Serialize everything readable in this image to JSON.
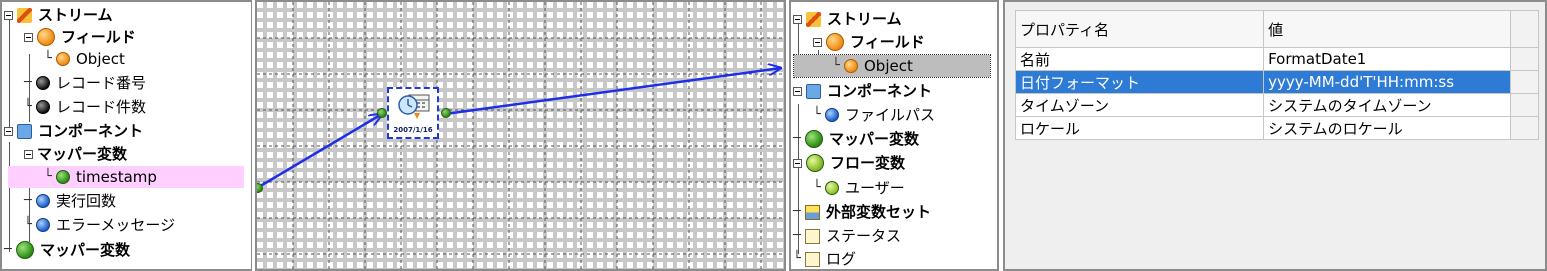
{
  "left_tree": {
    "items": [
      {
        "label": "ストリーム",
        "bold": true
      },
      {
        "label": "フィールド",
        "bold": true
      },
      {
        "label": "Object",
        "bold": false
      },
      {
        "label": "レコード番号",
        "bold": false
      },
      {
        "label": "レコード件数",
        "bold": false
      },
      {
        "label": "コンポーネント",
        "bold": true
      },
      {
        "label": "マッパー変数",
        "bold": true
      },
      {
        "label": "timestamp",
        "bold": false
      },
      {
        "label": "実行回数",
        "bold": false
      },
      {
        "label": "エラーメッセージ",
        "bold": false
      },
      {
        "label": "マッパー変数",
        "bold": true
      }
    ]
  },
  "canvas": {
    "component_label": "2007/1/16"
  },
  "right_tree": {
    "items": [
      {
        "label": "ストリーム",
        "bold": true
      },
      {
        "label": "フィールド",
        "bold": true
      },
      {
        "label": "Object",
        "bold": false
      },
      {
        "label": "コンポーネント",
        "bold": true
      },
      {
        "label": "ファイルパス",
        "bold": false
      },
      {
        "label": "マッパー変数",
        "bold": true
      },
      {
        "label": "フロー変数",
        "bold": true
      },
      {
        "label": "ユーザー",
        "bold": false
      },
      {
        "label": "外部変数セット",
        "bold": true
      },
      {
        "label": "ステータス",
        "bold": false
      },
      {
        "label": "ログ",
        "bold": false
      }
    ]
  },
  "properties": {
    "headers": {
      "name": "プロパティ名",
      "value": "値"
    },
    "rows": [
      {
        "name": "名前",
        "value": "FormatDate1"
      },
      {
        "name": "日付フォーマット",
        "value": "yyyy-MM-dd'T'HH:mm:ss"
      },
      {
        "name": "タイムゾーン",
        "value": "システムのタイムゾーン"
      },
      {
        "name": "ロケール",
        "value": "システムのロケール"
      }
    ]
  },
  "colors": {
    "selected_row": "#2e7bd6",
    "mapping_arrow": "#1f2fe8",
    "highlight": "#ffd0ff"
  }
}
